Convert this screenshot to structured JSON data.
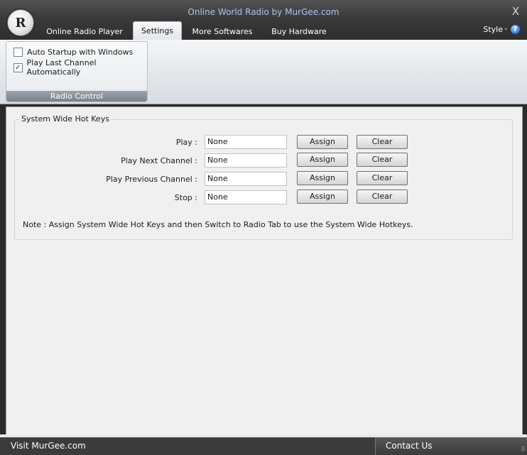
{
  "window": {
    "logo_letter": "R",
    "title": "Online World Radio by MurGee.com",
    "close_glyph": "X"
  },
  "tabs": [
    {
      "label": "Online Radio Player",
      "active": false
    },
    {
      "label": "Settings",
      "active": true
    },
    {
      "label": "More Softwares",
      "active": false
    },
    {
      "label": "Buy Hardware",
      "active": false
    }
  ],
  "style_menu": {
    "label": "Style",
    "caret": "⌄",
    "help_glyph": "?"
  },
  "ribbon_group": {
    "label": "Radio Control",
    "options": [
      {
        "label": "Auto Startup with Windows",
        "checked": false
      },
      {
        "label": "Play Last Channel Automatically",
        "checked": true
      }
    ]
  },
  "hotkeys": {
    "legend": "System Wide Hot Keys",
    "rows": [
      {
        "label": "Play :",
        "value": "None"
      },
      {
        "label": "Play Next Channel :",
        "value": "None"
      },
      {
        "label": "Play Previous Channel :",
        "value": "None"
      },
      {
        "label": "Stop :",
        "value": "None"
      }
    ],
    "assign_label": "Assign",
    "clear_label": "Clear",
    "note": "Note : Assign System Wide Hot Keys and then Switch to Radio Tab to use the System Wide Hotkeys."
  },
  "status_bar": {
    "left_link": "Visit MurGee.com",
    "right_link": "Contact Us"
  },
  "colors": {
    "title_text": "#a9c6ea",
    "chrome_dark": "#2b2b2b",
    "content_bg": "#f0f0f0"
  }
}
